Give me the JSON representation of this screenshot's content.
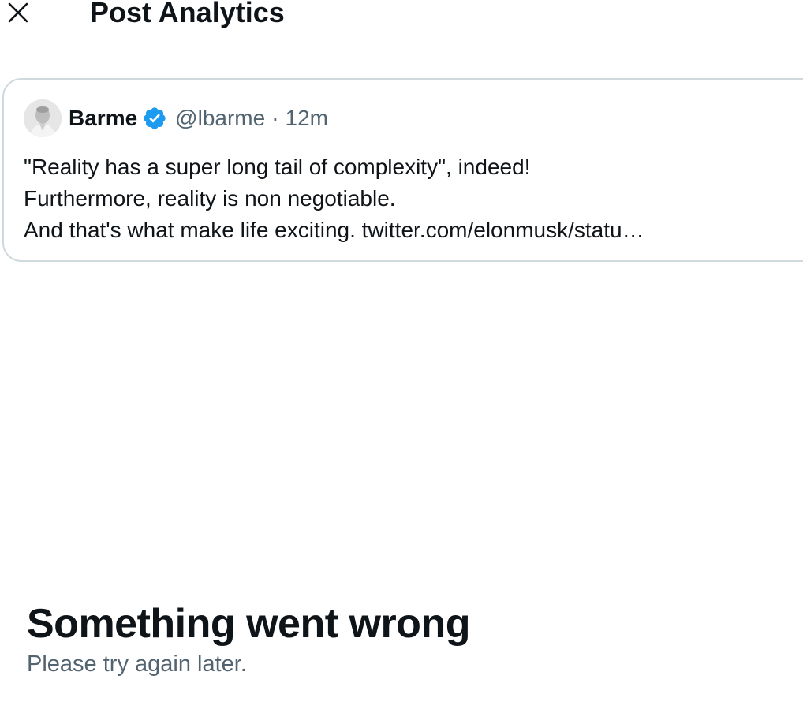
{
  "header": {
    "close_icon": "close-icon",
    "title": "Post Analytics"
  },
  "post": {
    "avatar_icon": "user-avatar",
    "author_name": "Barme",
    "verified_icon": "verified-badge-icon",
    "handle": "@lbarme",
    "separator": "·",
    "time": "12m",
    "lines": [
      "\"Reality has a super long tail of complexity\", indeed!",
      "Furthermore, reality is non negotiable.",
      "And that's what make life exciting. twitter.com/elonmusk/statu…"
    ]
  },
  "error": {
    "title": "Something went wrong",
    "subtitle": "Please try again later."
  },
  "colors": {
    "text_primary": "#0f1419",
    "text_secondary": "#536471",
    "border": "#cfd9de",
    "verified_blue": "#1d9bf0",
    "background": "#ffffff"
  }
}
